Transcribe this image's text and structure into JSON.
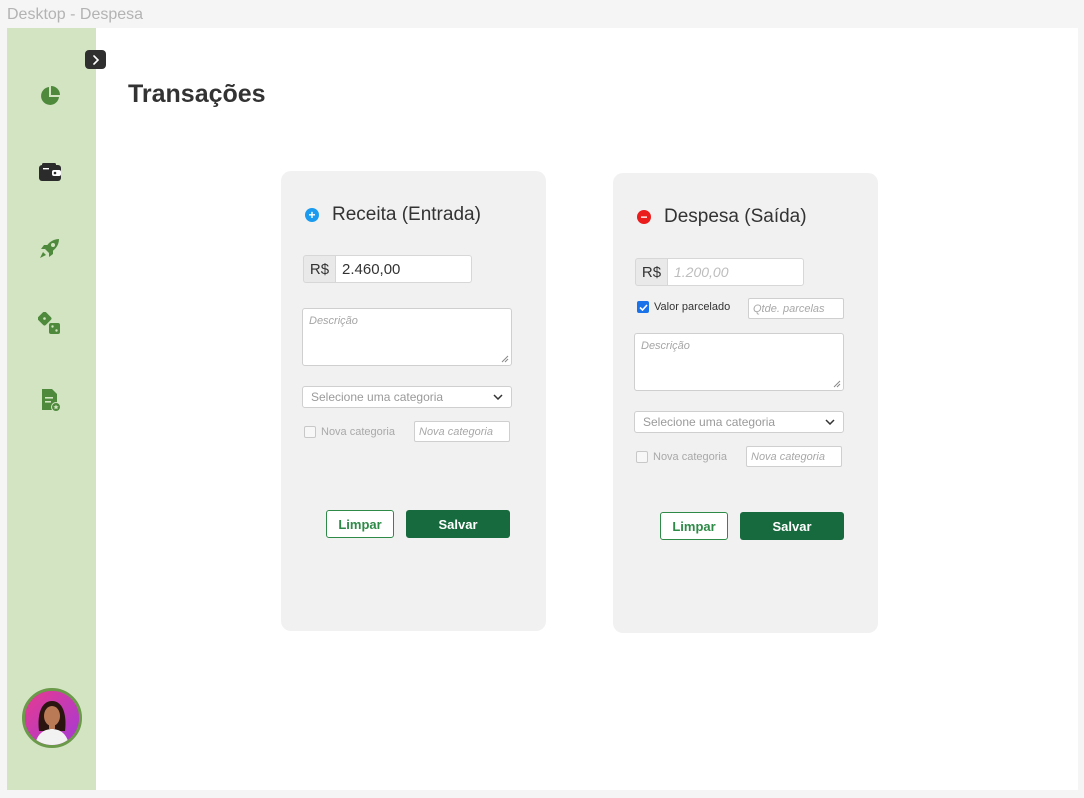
{
  "frame": {
    "title": "Desktop - Despesa"
  },
  "page": {
    "title": "Transações"
  },
  "sidebar": {
    "items": [
      {
        "icon": "pie-chart-icon"
      },
      {
        "icon": "wallet-icon"
      },
      {
        "icon": "rocket-icon"
      },
      {
        "icon": "dice-icon"
      },
      {
        "icon": "document-star-icon"
      }
    ],
    "accent": "#4f8a3c",
    "background": "#d3e4c3"
  },
  "receita": {
    "title": "Receita (Entrada)",
    "currency": "R$",
    "amount": "2.460,00",
    "description_placeholder": "Descrição",
    "category_placeholder": "Selecione uma categoria",
    "new_category_label": "Nova categoria",
    "new_category_placeholder": "Nova categoria",
    "clear_label": "Limpar",
    "save_label": "Salvar",
    "sign_color": "#1a9bef"
  },
  "despesa": {
    "title": "Despesa (Saída)",
    "currency": "R$",
    "amount_placeholder": "1.200,00",
    "installments_label": "Valor parcelado",
    "installments_checked": true,
    "installments_placeholder": "Qtde. parcelas",
    "description_placeholder": "Descrição",
    "category_placeholder": "Selecione uma categoria",
    "new_category_label": "Nova categoria",
    "new_category_placeholder": "Nova categoria",
    "clear_label": "Limpar",
    "save_label": "Salvar",
    "sign_color": "#ea1c1c"
  },
  "colors": {
    "primary_button": "#166a3d",
    "outline_button": "#2e8a47"
  }
}
